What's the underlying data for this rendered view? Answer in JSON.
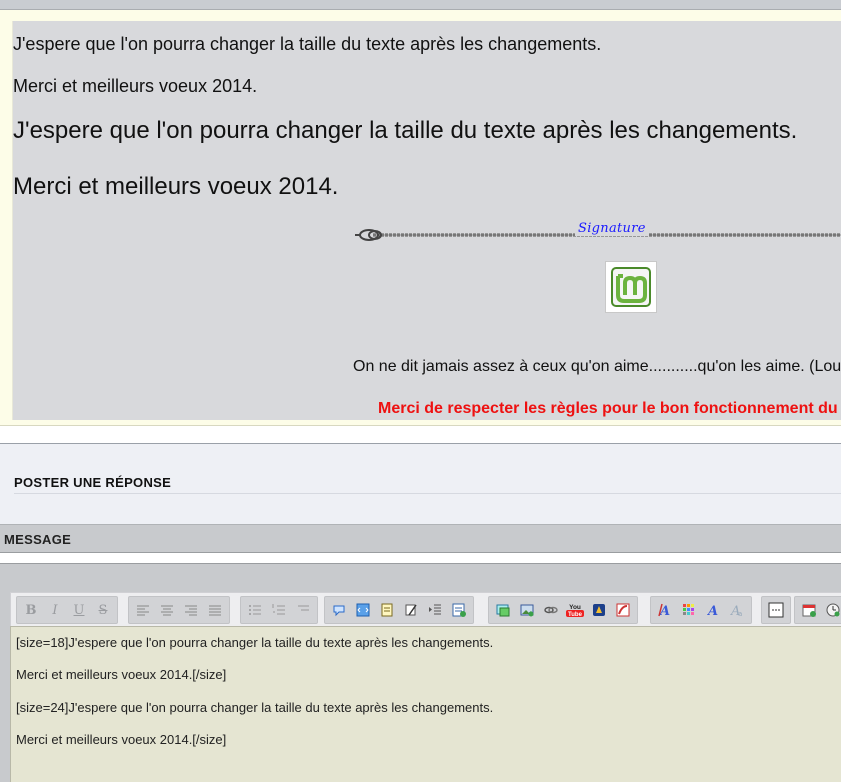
{
  "post": {
    "line1": "J'espere que l'on pourra changer la taille du texte après les changements.",
    "line2": "Merci et meilleurs voeux 2014.",
    "line3": "J'espere que l'on pourra changer la taille du texte après les changements.",
    "line4": "Merci et meilleurs voeux 2014."
  },
  "signature": {
    "label": "Signature",
    "quote": "On ne dit jamais assez à ceux qu'on aime...........qu'on les aime. (Louis",
    "rules": "Merci de respecter les règles pour le bon fonctionnement du f",
    "logo_icon": "linux-mint-logo-icon"
  },
  "reply": {
    "title": "POSTER UNE RÉPONSE"
  },
  "message": {
    "title": "MESSAGE"
  },
  "toolbar": {
    "bold": "B",
    "italic": "I",
    "underline": "U",
    "strike": "S",
    "youtube_top": "You",
    "youtube_bottom": "Tube"
  },
  "editor": {
    "lines": [
      "[size=18]J'espere que l'on pourra changer la taille du texte après les changements.",
      "Merci et meilleurs voeux 2014.[/size]",
      "[size=24]J'espere que l'on pourra changer la taille du texte après les changements.",
      "Merci et meilleurs voeux 2014.[/size]"
    ]
  },
  "colors": {
    "accent_blue": "#1a1aff",
    "rules_red": "#ee1111",
    "mint_green": "#6cb33f"
  }
}
